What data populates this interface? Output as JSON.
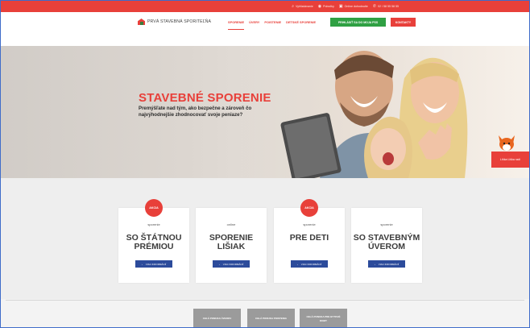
{
  "topbar": {
    "search_label": "Vyhľadávanie",
    "branches_label": "Pobočky",
    "appointment_label": "Online dohodnutie",
    "phone": "02 / 58 55 58 55"
  },
  "header": {
    "logo_text": "PRVÁ STAVEBNÁ SPORITEĽŇA",
    "nav": [
      {
        "label": "SPORENIE",
        "active": true
      },
      {
        "label": "ÚVERY",
        "active": false
      },
      {
        "label": "POISTENIE",
        "active": false
      },
      {
        "label": "DETSKÉ SPORENIE",
        "active": false
      }
    ],
    "login_label": "PRIHLÁSIŤ SA DO MOJA PSS",
    "contact_label": "KONTAKTY"
  },
  "hero": {
    "title": "STAVEBNÉ SPORENIE",
    "subtitle": "Premýšľate nad tým, ako bezpečne a zároveň čo najvýhodnejšie zhodnocovať svoje peniaze?",
    "side_tab_label": "Líška Liška radí"
  },
  "cards": [
    {
      "badge": "AKCIA",
      "kicker": "sporenie",
      "title": "SO ŠTÁTNOU PRÉMIOU",
      "button": "VIAC INFORMÁCIÍ"
    },
    {
      "badge": "",
      "kicker": "online",
      "title": "SPORENIE LIŠIAK",
      "button": "VIAC INFORMÁCIÍ"
    },
    {
      "badge": "AKCIA",
      "kicker": "sporenie",
      "title": "PRE DETI",
      "button": "VIAC INFORMÁCIÍ"
    },
    {
      "badge": "",
      "kicker": "sporenie",
      "title": "SO STAVEBNÝM ÚVEROM",
      "button": "VIAC INFORMÁCIÍ"
    }
  ],
  "bottom_buttons": [
    {
      "label": "CELÁ PONUKA ÚVEROV"
    },
    {
      "label": "CELÁ PONUKA POISTENIA"
    },
    {
      "label": "CELÁ PONUKA PRE BYTOVÉ DOMY"
    }
  ],
  "colors": {
    "brand_red": "#e8403a",
    "brand_blue": "#2c4b9b",
    "brand_green": "#2fa043"
  }
}
